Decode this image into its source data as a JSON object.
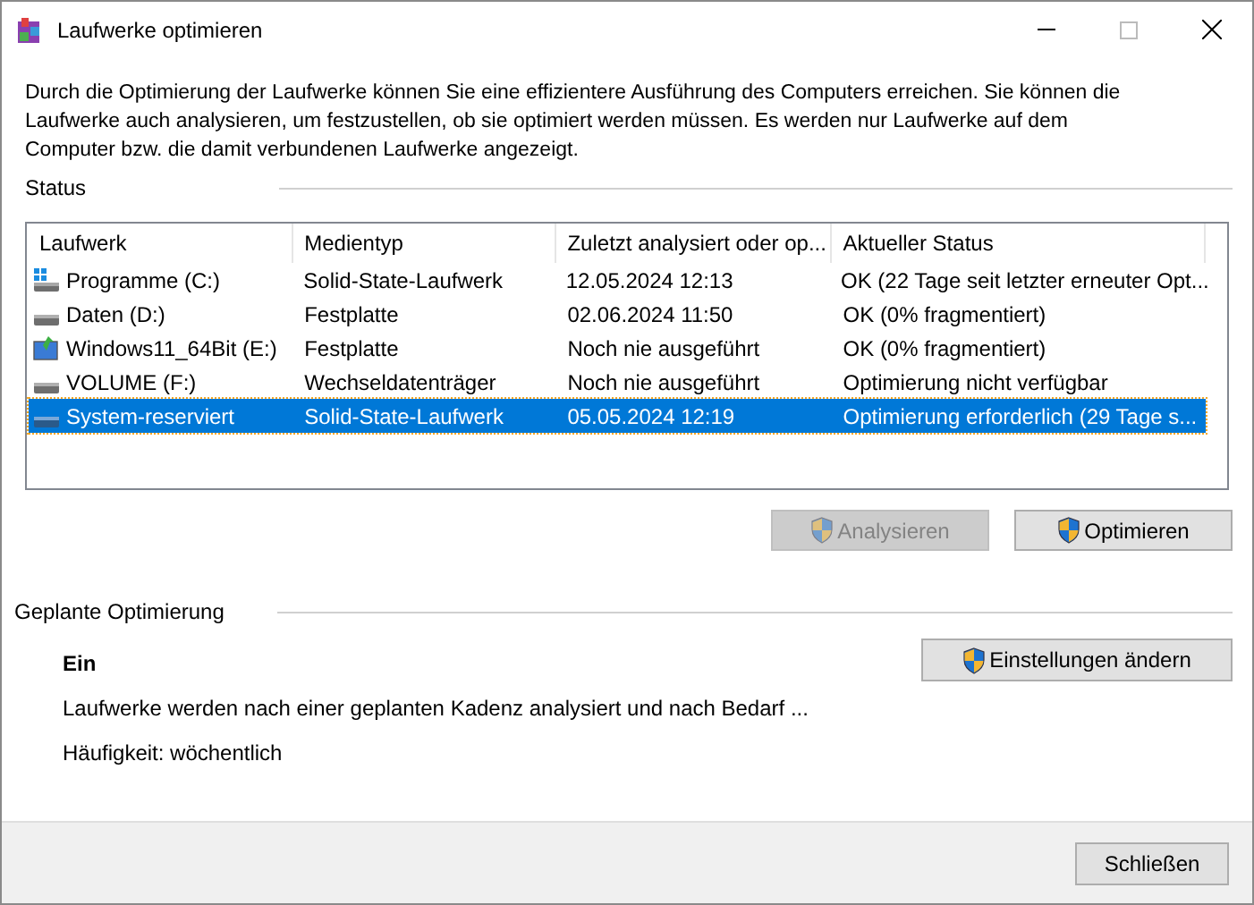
{
  "window": {
    "title": "Laufwerke optimieren"
  },
  "description": "Durch die Optimierung der Laufwerke können Sie eine effizientere Ausführung des Computers erreichen. Sie können die Laufwerke auch analysieren, um festzustellen, ob sie optimiert werden müssen. Es werden nur Laufwerke auf dem Computer bzw. die damit verbundenen Laufwerke angezeigt.",
  "status": {
    "heading": "Status",
    "table": {
      "columns": [
        "Laufwerk",
        "Medientyp",
        "Zuletzt analysiert oder op...",
        "Aktueller Status"
      ],
      "rows": [
        {
          "kind": "system",
          "selected": false,
          "cells": [
            "Programme (C:)",
            "Solid-State-Laufwerk",
            "12.05.2024 12:13",
            "OK (22 Tage seit letzter erneuter Opt..."
          ]
        },
        {
          "kind": "disk",
          "selected": false,
          "cells": [
            "Daten (D:)",
            "Festplatte",
            "02.06.2024 11:50",
            "OK (0% fragmentiert)"
          ]
        },
        {
          "kind": "setup",
          "selected": false,
          "cells": [
            "Windows11_64Bit (E:)",
            "Festplatte",
            "Noch nie ausgeführt",
            "OK (0% fragmentiert)"
          ]
        },
        {
          "kind": "disk",
          "selected": false,
          "cells": [
            "VOLUME (F:)",
            "Wechseldatenträger",
            "Noch nie ausgeführt",
            "Optimierung nicht verfügbar"
          ]
        },
        {
          "kind": "disk",
          "selected": true,
          "cells": [
            "System-reserviert",
            "Solid-State-Laufwerk",
            "05.05.2024 12:19",
            "Optimierung erforderlich (29 Tage s..."
          ]
        }
      ]
    },
    "buttons": [
      {
        "label": "Analysieren",
        "disabled": true
      },
      {
        "label": "Optimieren",
        "disabled": false
      }
    ]
  },
  "scheduled": {
    "heading": "Geplante Optimierung",
    "state": "Ein",
    "info": "Laufwerke werden nach einer geplanten Kadenz analysiert und nach Bedarf ...",
    "frequency": "Häufigkeit: wöchentlich",
    "button": "Einstellungen ändern"
  },
  "footer": {
    "close_button": "Schließen"
  }
}
